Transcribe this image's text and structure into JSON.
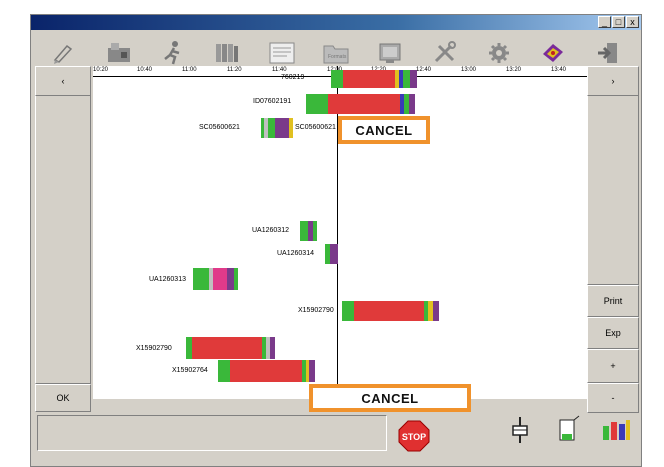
{
  "window": {
    "buttons": [
      "_",
      "□",
      "x"
    ]
  },
  "toolbar": [
    {
      "icon": "pen-icon"
    },
    {
      "icon": "machine-icon"
    },
    {
      "icon": "runner-icon"
    },
    {
      "icon": "books-icon"
    },
    {
      "icon": "document-icon"
    },
    {
      "icon": "folder-icon",
      "label": "Formats"
    },
    {
      "icon": "monitor-icon"
    },
    {
      "icon": "tools-icon"
    },
    {
      "icon": "gear-icon"
    },
    {
      "icon": "manual-icon"
    },
    {
      "icon": "exit-icon"
    }
  ],
  "nav": {
    "prev": "‹",
    "next": "›"
  },
  "side_buttons": {
    "ok": "OK",
    "print": "Print",
    "exp": "Exp",
    "plus": "+",
    "minus": "-"
  },
  "timeline": {
    "ticks": [
      "10:20",
      "10:40",
      "11:00",
      "11:20",
      "11:40",
      "12:00",
      "12:20",
      "12:40",
      "13:00",
      "13:20",
      "13:40"
    ],
    "current_time_marker": "12:06"
  },
  "jobs": [
    {
      "label": "760219",
      "color_main": "#e03a3a"
    },
    {
      "label": "ID07602191",
      "color_main": "#e03a3a"
    },
    {
      "label": "SC05600621",
      "color_main": "#7a3a8a"
    },
    {
      "label": "SC05600621",
      "color_main": "#7a3a8a"
    },
    {
      "label": "UA1260312",
      "color_main": "#7a3a8a"
    },
    {
      "label": "UA1260314",
      "color_main": "#7a3a8a"
    },
    {
      "label": "UA1260313",
      "color_main": "#e03a8a"
    },
    {
      "label": "X15902790",
      "color_main": "#e03a3a"
    },
    {
      "label": "X15902790",
      "color_main": "#e03a3a"
    },
    {
      "label": "X15902764",
      "color_main": "#e03a3a"
    }
  ],
  "annotations": {
    "cancel_top": "CANCEL",
    "cancel_bottom": "CANCEL"
  },
  "status": {
    "stop": "STOP"
  },
  "status_icons": [
    "stop-icon",
    "gauge-icon",
    "container-icon",
    "bottles-icon"
  ],
  "colors": {
    "accent": "#f0922c",
    "bar_red": "#e03a3a",
    "bar_green": "#3ab83a"
  }
}
